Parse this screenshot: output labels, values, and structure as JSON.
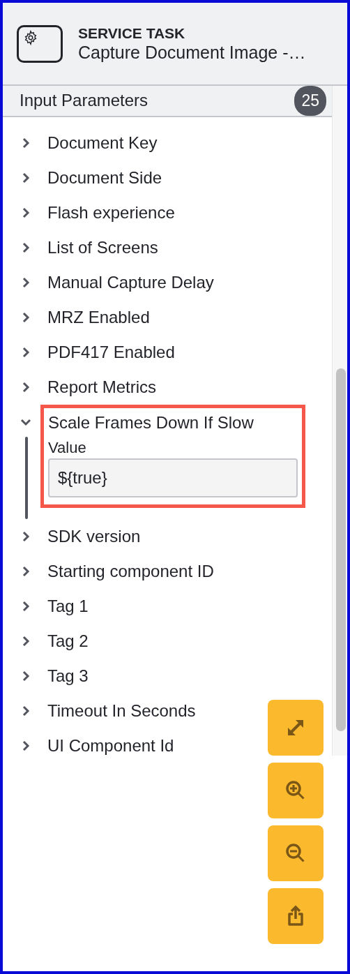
{
  "header": {
    "type": "SERVICE TASK",
    "name": "Capture Document Image -…"
  },
  "section": {
    "title": "Input Parameters",
    "count": "25"
  },
  "parameters": [
    {
      "label": "Document Key",
      "expanded": false
    },
    {
      "label": "Document Side",
      "expanded": false
    },
    {
      "label": "Flash experience",
      "expanded": false
    },
    {
      "label": "List of Screens",
      "expanded": false
    },
    {
      "label": "Manual Capture Delay",
      "expanded": false
    },
    {
      "label": "MRZ Enabled",
      "expanded": false
    },
    {
      "label": "PDF417 Enabled",
      "expanded": false
    },
    {
      "label": "Report Metrics",
      "expanded": false
    },
    {
      "label": "Scale Frames Down If Slow",
      "expanded": true,
      "highlighted": true,
      "field_label": "Value",
      "value": "${true}"
    },
    {
      "label": "SDK version",
      "expanded": false
    },
    {
      "label": "Starting component ID",
      "expanded": false
    },
    {
      "label": "Tag 1",
      "expanded": false
    },
    {
      "label": "Tag 2",
      "expanded": false
    },
    {
      "label": "Tag 3",
      "expanded": false
    },
    {
      "label": "Timeout In Seconds",
      "expanded": false
    },
    {
      "label": "UI Component Id",
      "expanded": false
    }
  ],
  "tools": [
    {
      "kind": "fit"
    },
    {
      "kind": "zoom-in"
    },
    {
      "kind": "zoom-out"
    },
    {
      "kind": "export"
    }
  ]
}
